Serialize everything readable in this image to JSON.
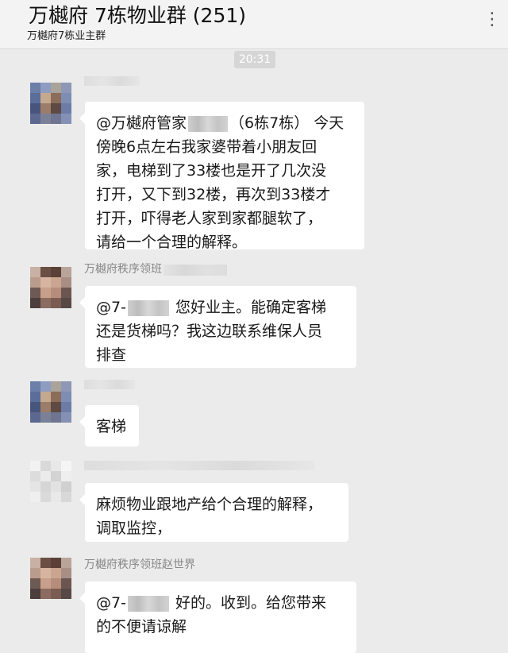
{
  "header": {
    "title": "万樾府 7栋物业群 (251)",
    "subtitle": "万樾府7栋业主群",
    "more_icon": "more-icon"
  },
  "chat": {
    "timestamp": "20:31",
    "messages": [
      {
        "sender": "",
        "lines": [
          {
            "before": "@万樾府管家",
            "after": "（6栋7栋） 今天"
          },
          {
            "text": "傍晚6点左右我家婆带着小朋友回"
          },
          {
            "text": "家，电梯到了33楼也是开了几次没"
          },
          {
            "text": "打开，又下到32楼，再次到33楼才"
          },
          {
            "text": "打开，吓得老人家到家都腿软了，"
          },
          {
            "text": "请给一个合理的解释。"
          }
        ]
      },
      {
        "sender": "万樾府秩序领班",
        "lines": [
          {
            "before": "@7-",
            "after": "  您好业主。能确定客梯"
          },
          {
            "text": "还是货梯吗？我这边联系维保人员"
          },
          {
            "text": "排查"
          }
        ]
      },
      {
        "sender": "",
        "lines": [
          {
            "text": "客梯"
          }
        ]
      },
      {
        "sender": "",
        "lines": [
          {
            "text": "麻烦物业跟地产给个合理的解释，"
          },
          {
            "text": "调取监控，"
          }
        ]
      },
      {
        "sender": "万樾府秩序领班赵世界",
        "lines": [
          {
            "before": "@7-",
            "after": "  好的。收到。给您带来"
          },
          {
            "text": "的不便请谅解"
          }
        ]
      }
    ]
  }
}
